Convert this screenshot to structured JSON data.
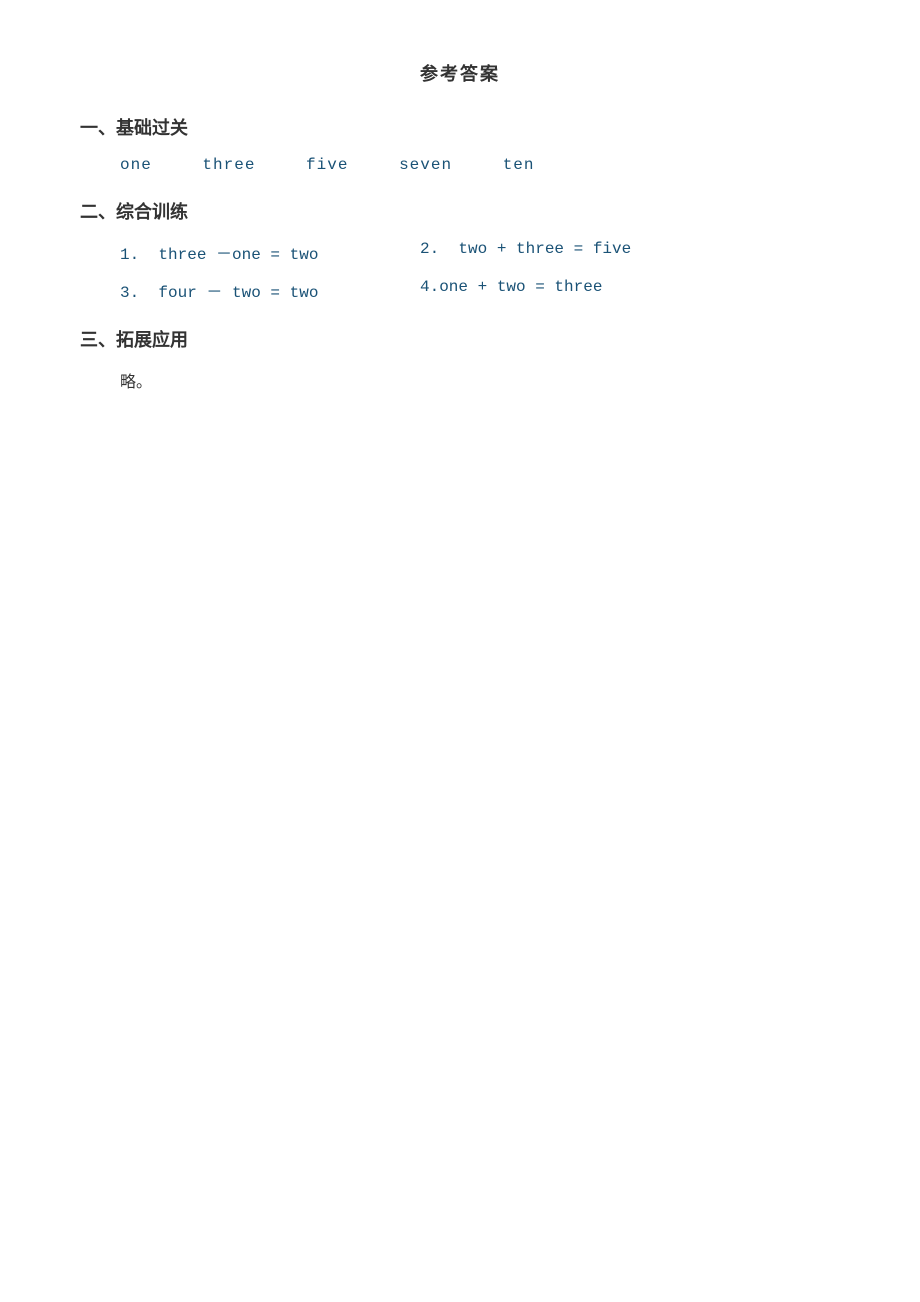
{
  "page": {
    "title": "参考答案",
    "sections": [
      {
        "id": "section-1",
        "heading": "一、基础过关",
        "type": "answer-row",
        "answers": [
          "one",
          "three",
          "five",
          "seven",
          "ten"
        ]
      },
      {
        "id": "section-2",
        "heading": "二、综合训练",
        "type": "exercises",
        "items": [
          {
            "number": "1.",
            "equation": "three －one = two"
          },
          {
            "number": "2.",
            "equation": "two + three = five"
          },
          {
            "number": "3.",
            "equation": "four － two = two"
          },
          {
            "number": "4.",
            "equation": "one + two = three"
          }
        ]
      },
      {
        "id": "section-3",
        "heading": "三、拓展应用",
        "type": "text",
        "content": "略。"
      }
    ]
  }
}
